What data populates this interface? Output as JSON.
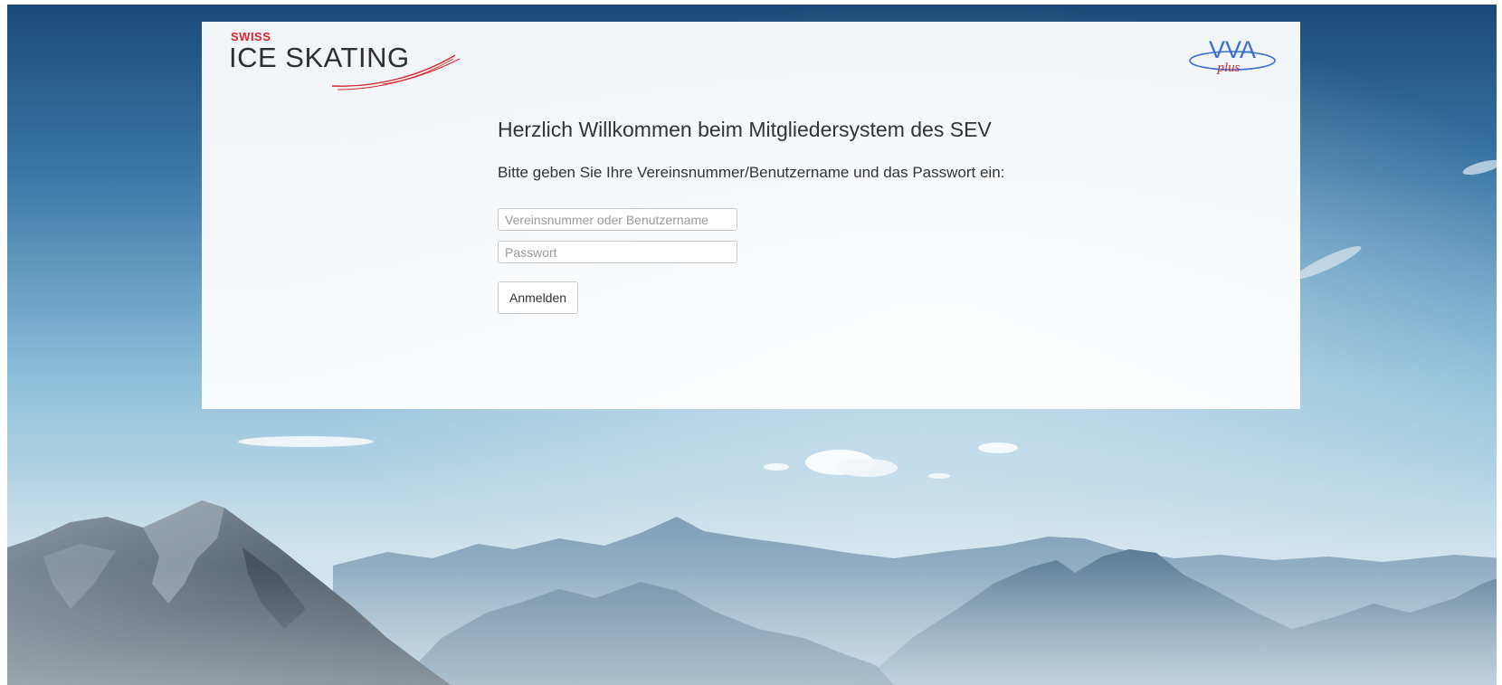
{
  "header": {
    "brand": {
      "small_text": "SWISS",
      "main_text": "ICE SKATING",
      "accent_color": "#d9252e"
    },
    "partner_logo": {
      "main_text": "VVA",
      "sub_text": "plus",
      "text_color": "#d9252e",
      "ring_color": "#3a6fd0"
    }
  },
  "login": {
    "title": "Herzlich Willkommen beim Mitgliedersystem des SEV",
    "instructions": "Bitte geben Sie Ihre Vereinsnummer/Benutzername und das Passwort ein:",
    "username": {
      "value": "",
      "placeholder": "Vereinsnummer oder Benutzername"
    },
    "password": {
      "value": "",
      "placeholder": "Passwort"
    },
    "submit_label": "Anmelden"
  },
  "background": {
    "description_icon": "mountain-landscape",
    "sky_top_color": "#1e4f7e",
    "sky_horizon_color": "#cfe3ee"
  }
}
